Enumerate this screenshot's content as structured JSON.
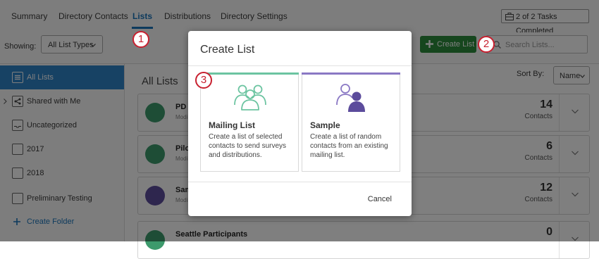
{
  "tabs": [
    {
      "label": "Summary"
    },
    {
      "label": "Directory Contacts"
    },
    {
      "label": "Lists"
    },
    {
      "label": "Distributions"
    },
    {
      "label": "Directory Settings"
    }
  ],
  "tasks_label": "2 of 2 Tasks Completed",
  "toolbar": {
    "showing_label": "Showing:",
    "list_type": "All List Types",
    "create_list": "Create List",
    "search_placeholder": "Search Lists..."
  },
  "sidebar": {
    "items": [
      {
        "label": "All Lists"
      },
      {
        "label": "Shared with Me"
      },
      {
        "label": "Uncategorized"
      },
      {
        "label": "2017"
      },
      {
        "label": "2018"
      },
      {
        "label": "Preliminary Testing"
      }
    ],
    "create_folder": "Create Folder"
  },
  "main": {
    "title": "All Lists",
    "sort_label": "Sort By:",
    "sort_value": "Name",
    "lists": [
      {
        "name": "PD F",
        "modified": "Modi",
        "count": "14",
        "count_label": "Contacts"
      },
      {
        "name": "Pilot",
        "modified": "Modi",
        "count": "6",
        "count_label": "Contacts"
      },
      {
        "name": "Sam",
        "modified": "Modi",
        "count": "12",
        "count_label": "Contacts"
      },
      {
        "name": "Seattle Participants",
        "modified": "",
        "count": "0",
        "count_label": ""
      }
    ]
  },
  "modal": {
    "title": "Create List",
    "options": [
      {
        "title": "Mailing List",
        "description": "Create a list of selected contacts to send surveys and distributions."
      },
      {
        "title": "Sample",
        "description": "Create a list of random contacts from an existing mailing list."
      }
    ],
    "cancel": "Cancel"
  },
  "callouts": [
    "1",
    "2",
    "3"
  ],
  "colors": {
    "accent": "#1a75bb",
    "green": "#2d8c3c",
    "mailing": "#6cc4a1",
    "sample": "#8a78c4",
    "callout": "#c8202f"
  }
}
